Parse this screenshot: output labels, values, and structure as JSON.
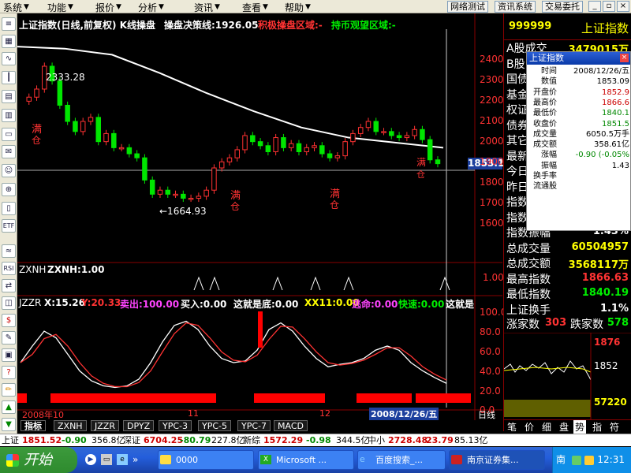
{
  "menu": {
    "items": [
      "系统",
      "功能",
      "报价",
      "分析",
      "资讯",
      "查看",
      "帮助"
    ]
  },
  "toolbar": {
    "btn1": "网络测试",
    "btn2": "资讯系统",
    "btn3": "交易委托"
  },
  "chart_header": {
    "title": "上证指数(日线,前复权) K线操盘",
    "line1_label": "操盘决策线:1926.05",
    "line2_label": "积极操盘区域:-",
    "line3_label": "持币观望区域:-"
  },
  "annotations": {
    "high": "2333.28",
    "low": "←1664.93",
    "buy1": "满",
    "buy1b": "仓",
    "last_price": "1853.1"
  },
  "y_axis_ticks": [
    "2400",
    "2300",
    "2200",
    "2100",
    "2000",
    "1900",
    "1800",
    "1700",
    "1600"
  ],
  "indicator1": {
    "name": "ZXNH",
    "value_label": "ZXNH:1.00",
    "ticks": [
      "1.00",
      "0.00"
    ]
  },
  "indicator2": {
    "name": "JZZR",
    "x_label": "X:15.26",
    "y_label": "Y:20.33",
    "sell_label": "卖出:100.00",
    "buy_label": "买入:0.00",
    "bottom_label": "这就是底:0.00",
    "xx11_label": "XX11:0.00",
    "danger_label": "逃命:0.00",
    "fast_label": "快速:0.00",
    "extra_label": "这就是",
    "ticks": [
      "100.0",
      "80.0",
      "60.0",
      "40.0",
      "20.0",
      "0.0"
    ]
  },
  "x_axis": {
    "labels": [
      "2008年10",
      "11",
      "12"
    ],
    "cursor_date": "2008/12/26/五",
    "period": "日线"
  },
  "tabs": [
    "指标",
    "ZXNH",
    "JZZR",
    "DPYZ",
    "YPC-3",
    "YPC-5",
    "YPC-7",
    "MACD"
  ],
  "right_panel": {
    "code": "999999",
    "name": "上证指数",
    "rows": [
      {
        "label": "A股成交",
        "value": "3479015万"
      },
      {
        "label": "B股",
        "value": ""
      },
      {
        "label": "国债",
        "value": ""
      },
      {
        "label": "基金",
        "value": ""
      },
      {
        "label": "权证",
        "value": ""
      },
      {
        "label": "债券",
        "value": ""
      },
      {
        "label": "其它",
        "value": ""
      },
      {
        "label": "最新",
        "value": ""
      },
      {
        "label": "今日",
        "value": ""
      },
      {
        "label": "昨日",
        "value": ""
      },
      {
        "label": "指数",
        "value": ""
      },
      {
        "label": "指数涨幅",
        "value": "-0.05%"
      },
      {
        "label": "指数振幅",
        "value": "1.43%"
      },
      {
        "label": "总成交量",
        "value": "60504957"
      },
      {
        "label": "总成交额",
        "value": "3568117万"
      },
      {
        "label": "最高指数",
        "value": "1866.63"
      },
      {
        "label": "最低指数",
        "value": "1840.19"
      },
      {
        "label": "上证换手",
        "value": "1.1%"
      }
    ],
    "up_label": "涨家数",
    "up_count": "303",
    "down_label": "跌家数",
    "down_count": "578",
    "mini_ticks": [
      "1876",
      "1852",
      "57220"
    ],
    "bottom_tabs": [
      "笔",
      "价",
      "细",
      "盘",
      "势",
      "指",
      "符"
    ]
  },
  "popup": {
    "title": "上证指数",
    "rows": [
      {
        "label": "时间",
        "value": "2008/12/26/五"
      },
      {
        "label": "数值",
        "value": "1853.09"
      },
      {
        "label": "开盘价",
        "value": "1852.9"
      },
      {
        "label": "最高价",
        "value": "1866.6"
      },
      {
        "label": "最低价",
        "value": "1840.1"
      },
      {
        "label": "收盘价",
        "value": "1851.5"
      },
      {
        "label": "成交量",
        "value": "6050.5万手"
      },
      {
        "label": "成交额",
        "value": "358.61亿"
      },
      {
        "label": "涨幅",
        "value": "-0.90 (-0.05%"
      },
      {
        "label": "振幅",
        "value": "1.43"
      },
      {
        "label": "换手率",
        "value": ""
      },
      {
        "label": "流通股",
        "value": ""
      }
    ]
  },
  "ticker": {
    "sh_label": "上证",
    "sh_val": "1851.52",
    "sh_chg": "-0.90",
    "sh_amt": "356.8亿",
    "sz_label": "深证",
    "sz_val": "6704.25",
    "sz_chg": "-80.79",
    "sz_amt": "227.8亿",
    "xz_label": "新综",
    "xz_val": "1572.29",
    "xz_chg": "-0.98",
    "xz_amt": "344.5亿",
    "zx_label": "中小",
    "zx_val": "2728.48",
    "zx_chg": "23.79",
    "zx_amt": "85.13亿"
  },
  "taskbar": {
    "start": "开始",
    "tasks": [
      "0000",
      "Microsoft ...",
      "百度搜索_...",
      "南京证券集..."
    ],
    "ime": "南",
    "clock": "12:31"
  },
  "colors": {
    "up": "#ff3232",
    "down": "#00e600",
    "white": "#ffffff",
    "yellow": "#ffff00",
    "magenta": "#ff40ff"
  },
  "chart_data": {
    "type": "candlestick",
    "title": "上证指数(日线,前复权)",
    "ylim": [
      1600,
      2450
    ],
    "period": "2008/10 - 2008/12/26",
    "annotated_high": 2333.28,
    "annotated_low": 1664.93,
    "last": {
      "date": "2008/12/26",
      "open": 1852.9,
      "high": 1866.6,
      "low": 1840.1,
      "close": 1851.5
    },
    "ma_line": "white moving average line, declining from ~2420 to ~1900"
  }
}
